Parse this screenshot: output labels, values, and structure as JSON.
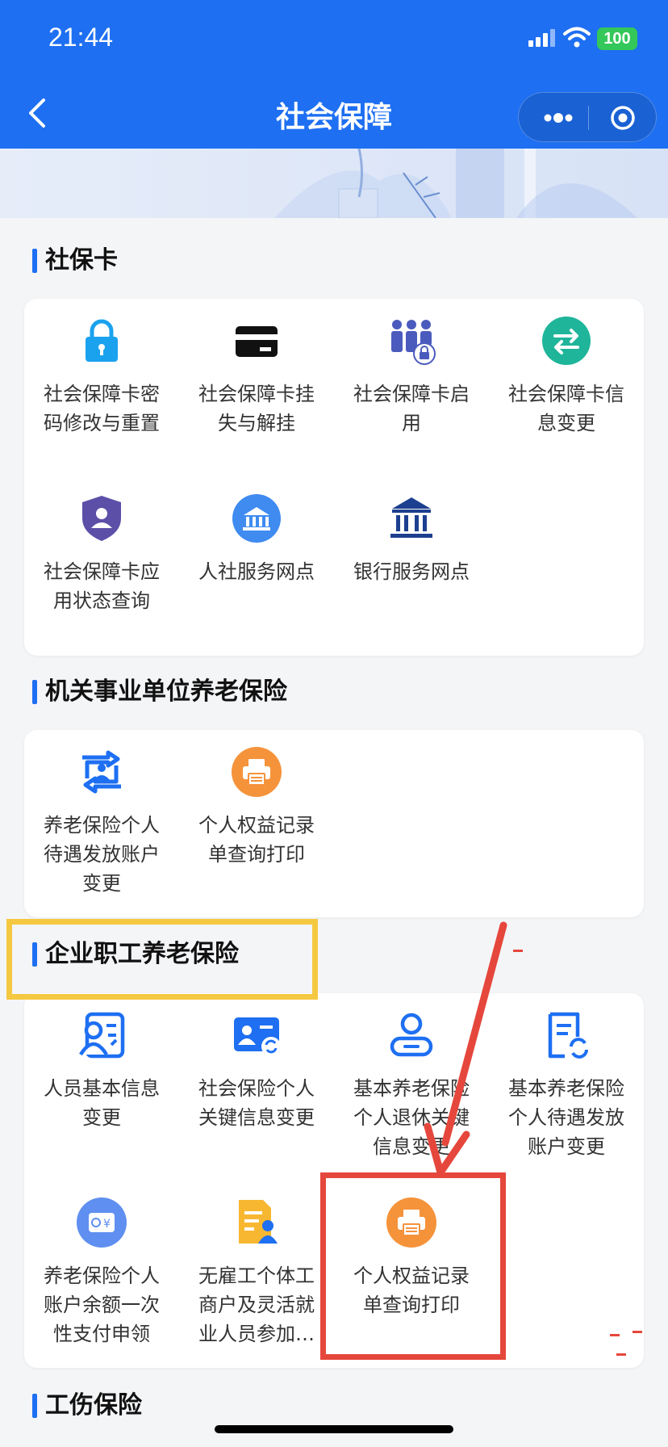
{
  "status_bar": {
    "time": "21:44",
    "battery": "100"
  },
  "nav": {
    "title": "社会保障"
  },
  "sections": {
    "sbk": {
      "title": "社保卡",
      "items": [
        {
          "label": "社会保障卡密\n码修改与重置",
          "icon": "lock-icon"
        },
        {
          "label": "社会保障卡挂\n失与解挂",
          "icon": "card-icon"
        },
        {
          "label": "社会保障卡启\n用",
          "icon": "people-lock-icon"
        },
        {
          "label": "社会保障卡信\n息变更",
          "icon": "swap-icon"
        },
        {
          "label": "社会保障卡应\n用状态查询",
          "icon": "shield-user-icon"
        },
        {
          "label": "人社服务网点",
          "icon": "building-icon"
        },
        {
          "label": "银行服务网点",
          "icon": "bank-icon"
        }
      ]
    },
    "jgsy": {
      "title": "机关事业单位养老保险",
      "items": [
        {
          "label": "养老保险个人\n待遇发放账户\n变更",
          "icon": "account-change-icon"
        },
        {
          "label": "个人权益记录\n单查询打印",
          "icon": "printer-icon"
        }
      ]
    },
    "qyzg": {
      "title": "企业职工养老保险",
      "items": [
        {
          "label": "人员基本信息\n变更",
          "icon": "person-card-icon"
        },
        {
          "label": "社会保险个人\n关键信息变更",
          "icon": "id-refresh-icon"
        },
        {
          "label": "基本养老保险\n个人退休关键\n信息变更",
          "icon": "user-retire-icon"
        },
        {
          "label": "基本养老保险\n个人待遇发放\n账户变更",
          "icon": "doc-refresh-icon"
        },
        {
          "label": "养老保险个人\n账户余额一次\n性支付申领",
          "icon": "balance-icon"
        },
        {
          "label": "无雇工个体工\n商户及灵活就\n业人员参加…",
          "icon": "form-person-icon"
        },
        {
          "label": "个人权益记录\n单查询打印",
          "icon": "printer-icon"
        }
      ]
    },
    "gs": {
      "title": "工伤保险"
    }
  },
  "colors": {
    "header": "#1e6ff2",
    "highlight_yellow": "#f5c842",
    "highlight_red": "#e6473c",
    "orange": "#f5933b"
  }
}
